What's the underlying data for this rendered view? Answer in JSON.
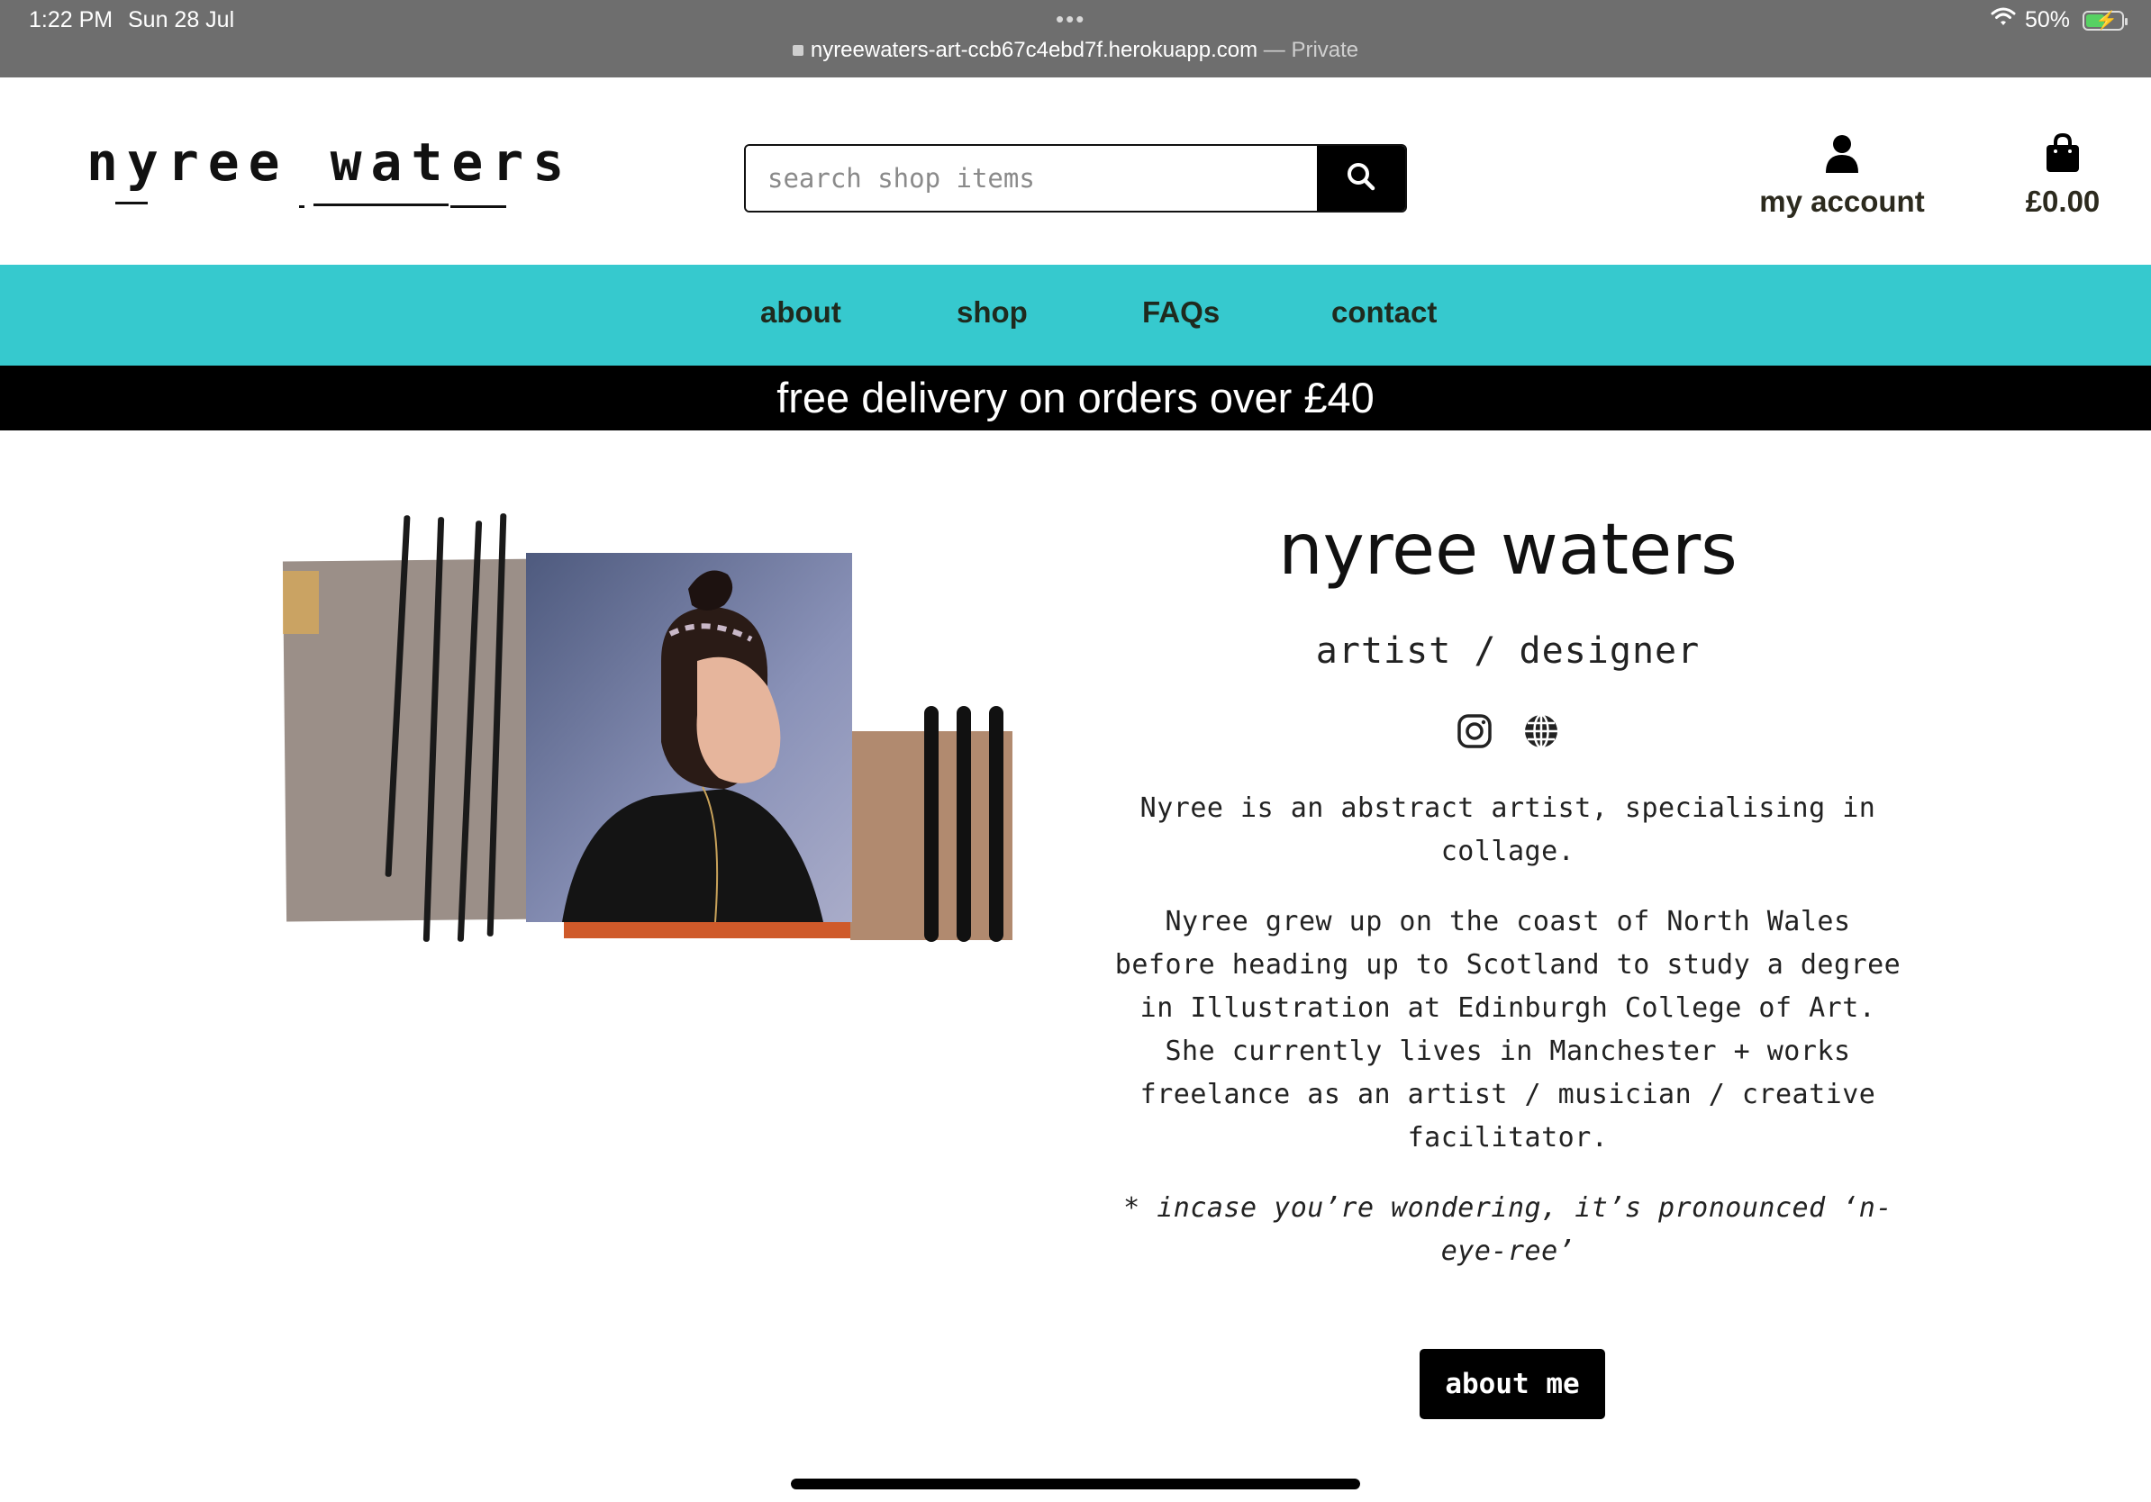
{
  "status_bar": {
    "time": "1:22 PM",
    "date": "Sun 28 Jul",
    "battery": "50%",
    "battery_level": 0.5,
    "url": "nyreewaters-art-ccb67c4ebd7f.herokuapp.com",
    "privacy": "— Private"
  },
  "header": {
    "logo_word1": "nyree",
    "logo_word2": "waters",
    "search_placeholder": "search shop items",
    "account_label": "my account",
    "bag_total": "£0.00"
  },
  "nav": {
    "items": [
      "about",
      "shop",
      "FAQs",
      "contact"
    ]
  },
  "banner": {
    "text": "free delivery on orders over £40"
  },
  "main": {
    "title": "nyree waters",
    "subtitle": "artist / designer",
    "social_icons": [
      "instagram-icon",
      "globe-icon"
    ],
    "para1": "Nyree is an abstract artist, specialising in collage.",
    "para2": "Nyree grew up on the coast of North Wales before heading up to Scotland to study a degree in Illustration at Edinburgh College of Art. She currently lives in Manchester + works freelance as an artist / musician / creative facilitator.",
    "note": "* incase you’re wondering, it’s pronounced ‘n-eye-ree’",
    "button_label": "about me"
  },
  "colors": {
    "nav_bg": "#36c9ce",
    "banner_bg": "#000000",
    "status_bg": "#6e6e6e",
    "text_dark": "#2c2a1e"
  }
}
